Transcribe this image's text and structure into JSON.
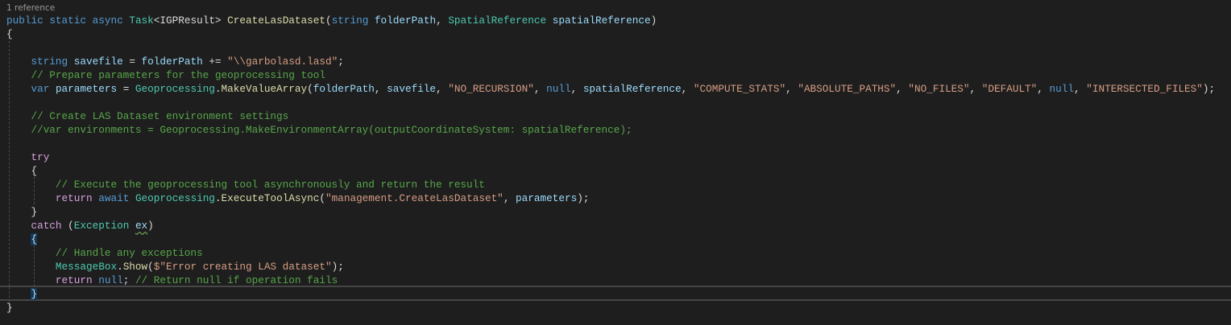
{
  "codelens": "1 reference",
  "colors": {
    "background": "#1e1e1e",
    "keyword": "#569cd6",
    "control": "#d8a0df",
    "type": "#4ec9b0",
    "method": "#dcdcaa",
    "parameter": "#9cdcfe",
    "string": "#d69d85",
    "comment": "#57a64a"
  },
  "lines": [
    {
      "indent": 0,
      "tokens": [
        [
          "public",
          "kw"
        ],
        [
          " ",
          "pn"
        ],
        [
          "static",
          "kw"
        ],
        [
          " ",
          "pn"
        ],
        [
          "async",
          "kw"
        ],
        [
          " ",
          "pn"
        ],
        [
          "Task",
          "type"
        ],
        [
          "<IGPResult> ",
          "pn"
        ],
        [
          "CreateLasDataset",
          "fn"
        ],
        [
          "(",
          "pn"
        ],
        [
          "string",
          "kw"
        ],
        [
          " ",
          "pn"
        ],
        [
          "folderPath",
          "param"
        ],
        [
          ", ",
          "pn"
        ],
        [
          "SpatialReference",
          "type"
        ],
        [
          " ",
          "pn"
        ],
        [
          "spatialReference",
          "param"
        ],
        [
          ")",
          "pn"
        ]
      ]
    },
    {
      "indent": 0,
      "tokens": [
        [
          "{",
          "pn"
        ]
      ]
    },
    {
      "indent": 0,
      "tokens": []
    },
    {
      "indent": 4,
      "tokens": [
        [
          "string",
          "kw"
        ],
        [
          " ",
          "pn"
        ],
        [
          "savefile",
          "param"
        ],
        [
          " = ",
          "pn"
        ],
        [
          "folderPath",
          "param"
        ],
        [
          " += ",
          "pn"
        ],
        [
          "\"\\\\garbolasd.lasd\"",
          "str"
        ],
        [
          ";",
          "pn"
        ]
      ]
    },
    {
      "indent": 4,
      "tokens": [
        [
          "// Prepare parameters for the geoprocessing tool",
          "cmt"
        ]
      ]
    },
    {
      "indent": 4,
      "tokens": [
        [
          "var",
          "kw"
        ],
        [
          " ",
          "pn"
        ],
        [
          "parameters",
          "param"
        ],
        [
          " = ",
          "pn"
        ],
        [
          "Geoprocessing",
          "type"
        ],
        [
          ".",
          "pn"
        ],
        [
          "MakeValueArray",
          "fn"
        ],
        [
          "(",
          "pn"
        ],
        [
          "folderPath",
          "param"
        ],
        [
          ", ",
          "pn"
        ],
        [
          "savefile",
          "param"
        ],
        [
          ", ",
          "pn"
        ],
        [
          "\"NO_RECURSION\"",
          "str"
        ],
        [
          ", ",
          "pn"
        ],
        [
          "null",
          "kw"
        ],
        [
          ", ",
          "pn"
        ],
        [
          "spatialReference",
          "param"
        ],
        [
          ", ",
          "pn"
        ],
        [
          "\"COMPUTE_STATS\"",
          "str"
        ],
        [
          ", ",
          "pn"
        ],
        [
          "\"ABSOLUTE_PATHS\"",
          "str"
        ],
        [
          ", ",
          "pn"
        ],
        [
          "\"NO_FILES\"",
          "str"
        ],
        [
          ", ",
          "pn"
        ],
        [
          "\"DEFAULT\"",
          "str"
        ],
        [
          ", ",
          "pn"
        ],
        [
          "null",
          "kw"
        ],
        [
          ", ",
          "pn"
        ],
        [
          "\"INTERSECTED_FILES\"",
          "str"
        ],
        [
          ");",
          "pn"
        ]
      ]
    },
    {
      "indent": 0,
      "tokens": []
    },
    {
      "indent": 4,
      "tokens": [
        [
          "// Create LAS Dataset environment settings",
          "cmt"
        ]
      ]
    },
    {
      "indent": 4,
      "tokens": [
        [
          "//var environments = Geoprocessing.MakeEnvironmentArray(outputCoordinateSystem: spatialReference);",
          "cmt"
        ]
      ]
    },
    {
      "indent": 0,
      "tokens": []
    },
    {
      "indent": 4,
      "tokens": [
        [
          "try",
          "ctl"
        ]
      ]
    },
    {
      "indent": 4,
      "tokens": [
        [
          "{",
          "pn"
        ]
      ]
    },
    {
      "indent": 8,
      "tokens": [
        [
          "// Execute the geoprocessing tool asynchronously and return the result",
          "cmt"
        ]
      ]
    },
    {
      "indent": 8,
      "tokens": [
        [
          "return",
          "ctl"
        ],
        [
          " ",
          "pn"
        ],
        [
          "await",
          "kw"
        ],
        [
          " ",
          "pn"
        ],
        [
          "Geoprocessing",
          "type"
        ],
        [
          ".",
          "pn"
        ],
        [
          "ExecuteToolAsync",
          "fn"
        ],
        [
          "(",
          "pn"
        ],
        [
          "\"management.CreateLasDataset\"",
          "str"
        ],
        [
          ", ",
          "pn"
        ],
        [
          "parameters",
          "param"
        ],
        [
          ");",
          "pn"
        ]
      ]
    },
    {
      "indent": 4,
      "tokens": [
        [
          "}",
          "pn"
        ]
      ]
    },
    {
      "indent": 4,
      "tokens": [
        [
          "catch",
          "ctl"
        ],
        [
          " (",
          "pn"
        ],
        [
          "Exception",
          "type"
        ],
        [
          " ",
          "pn"
        ],
        [
          "ex",
          "param squig"
        ],
        [
          ")",
          "pn"
        ]
      ]
    },
    {
      "indent": 4,
      "tokens": [
        [
          "{",
          "pn brace-match"
        ]
      ]
    },
    {
      "indent": 8,
      "tokens": [
        [
          "// Handle any exceptions",
          "cmt"
        ]
      ]
    },
    {
      "indent": 8,
      "tokens": [
        [
          "MessageBox",
          "type"
        ],
        [
          ".",
          "pn"
        ],
        [
          "Show",
          "fn"
        ],
        [
          "(",
          "pn"
        ],
        [
          "$\"Error creating LAS dataset\"",
          "str"
        ],
        [
          ");",
          "pn"
        ]
      ]
    },
    {
      "indent": 8,
      "tokens": [
        [
          "return",
          "ctl"
        ],
        [
          " ",
          "pn"
        ],
        [
          "null",
          "kw"
        ],
        [
          "; ",
          "pn"
        ],
        [
          "// Return null if operation fails",
          "cmt"
        ]
      ]
    },
    {
      "indent": 4,
      "tokens": [
        [
          "}",
          "pn brace-match"
        ]
      ]
    },
    {
      "indent": 0,
      "tokens": [
        [
          "}",
          "pn"
        ]
      ]
    }
  ]
}
